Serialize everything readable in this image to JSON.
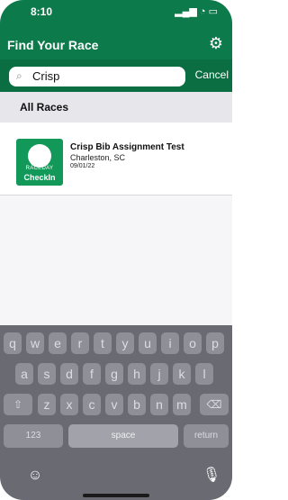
{
  "status_bar": {
    "time": "8:10",
    "indicators": "signal wifi battery"
  },
  "header": {
    "title": "Find Your Race",
    "settings_icon": "gear-icon"
  },
  "search": {
    "value": "Crisp",
    "placeholder": "",
    "cancel_label": "Cancel"
  },
  "section": {
    "title": "All Races"
  },
  "races": [
    {
      "name": "Crisp Bib Assignment Test",
      "location": "Charleston, SC",
      "date": "09/01/22",
      "logo": {
        "line1": "RACEDAY",
        "line2": "CheckIn"
      }
    }
  ],
  "keyboard": {
    "row1": [
      "q",
      "w",
      "e",
      "r",
      "t",
      "y",
      "u",
      "i",
      "o",
      "p"
    ],
    "row2": [
      "a",
      "s",
      "d",
      "f",
      "g",
      "h",
      "j",
      "k",
      "l"
    ],
    "row3": [
      "z",
      "x",
      "c",
      "v",
      "b",
      "n",
      "m"
    ],
    "shift_icon": "shift-icon",
    "backspace_icon": "backspace-icon",
    "numbers_label": "123",
    "space_label": "space",
    "return_label": "return",
    "emoji_icon": "emoji-icon",
    "mic_icon": "microphone-icon"
  },
  "colors": {
    "header_green": "#0c7a4a",
    "search_green": "#0a6e42",
    "logo_green": "#12995a"
  }
}
